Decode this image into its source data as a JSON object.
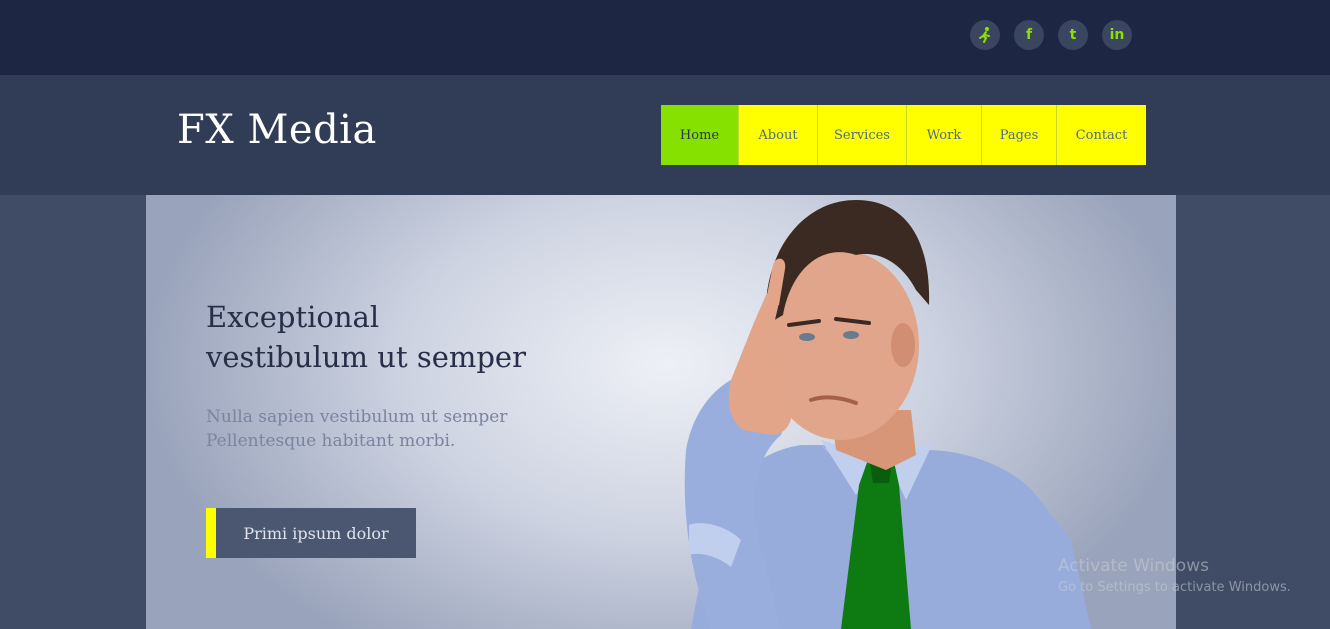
{
  "social": [
    {
      "icon": "aim-runner-icon",
      "glyph": ""
    },
    {
      "icon": "facebook-icon",
      "glyph": "f"
    },
    {
      "icon": "twitter-icon",
      "glyph": "t"
    },
    {
      "icon": "linkedin-icon",
      "glyph": "in"
    }
  ],
  "brand": {
    "name": "FX Media"
  },
  "nav": {
    "items": [
      "Home",
      "About",
      "Services",
      "Work",
      "Pages",
      "Contact"
    ],
    "active": "Home"
  },
  "hero": {
    "title_line1": "Exceptional",
    "title_line2": "vestibulum ut semper",
    "subtitle_line1": "Nulla sapien vestibulum ut semper",
    "subtitle_line2": "Pellentesque habitant morbi.",
    "cta_label": "Primi ipsum dolor"
  },
  "colors": {
    "accent_yellow": "#ffff00",
    "accent_green": "#86e000",
    "topbar": "#1d2743",
    "header": "#313c57"
  },
  "watermark": {
    "title": "Activate Windows",
    "subtitle": "Go to Settings to activate Windows."
  }
}
